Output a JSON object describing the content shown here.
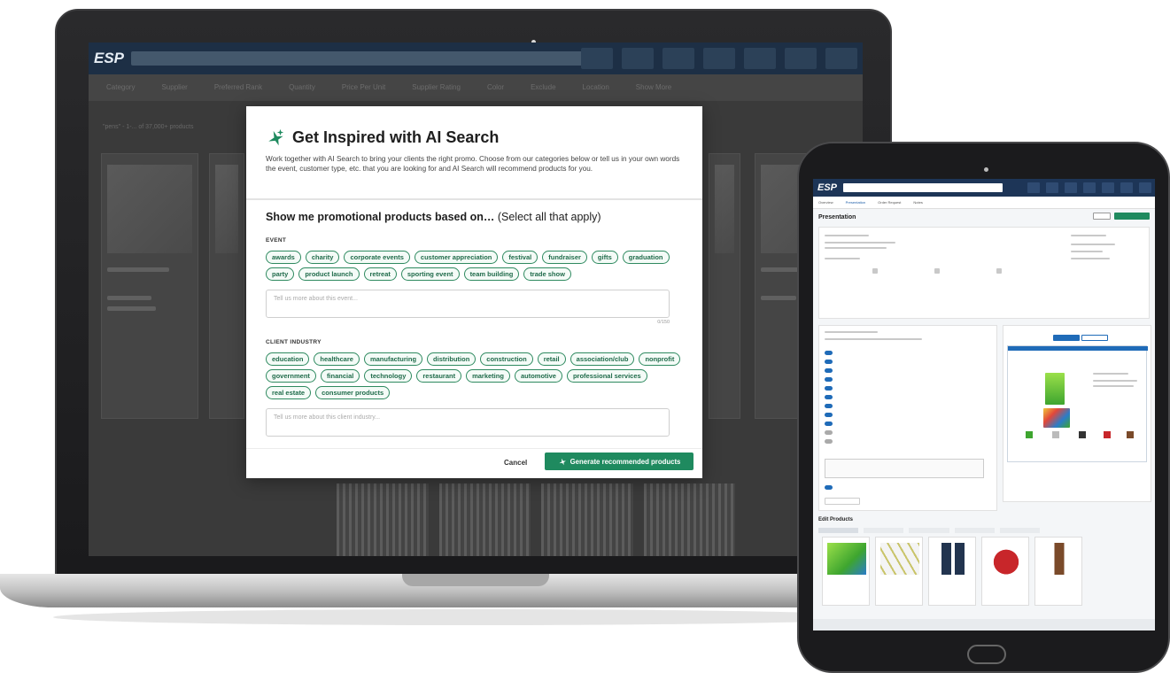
{
  "laptop": {
    "brand": "ESP",
    "filters": [
      "Category",
      "Supplier",
      "Preferred Rank",
      "Quantity",
      "Price Per Unit",
      "Supplier Rating",
      "Color",
      "Exclude",
      "Location",
      "Show More"
    ],
    "results_text": "\"pens\" - 1-... of 37,000+ products",
    "modal": {
      "title": "Get Inspired with AI Search",
      "intro": "Work together with AI Search to bring your clients the right promo. Choose from our categories below or tell us in your own words the event, customer type, etc. that you are looking for and AI Search will recommend products for you.",
      "show_me_bold": "Show me promotional products based on…",
      "show_me_rest": "(Select all that apply)",
      "event_label": "EVENT",
      "event_chips": [
        "awards",
        "charity",
        "corporate events",
        "customer appreciation",
        "festival",
        "fundraiser",
        "gifts",
        "graduation",
        "party",
        "product launch",
        "retreat",
        "sporting event",
        "team building",
        "trade show"
      ],
      "event_placeholder": "Tell us more about this event...",
      "event_counter": "0/150",
      "industry_label": "CLIENT INDUSTRY",
      "industry_chips": [
        "education",
        "healthcare",
        "manufacturing",
        "distribution",
        "construction",
        "retail",
        "association/club",
        "nonprofit",
        "government",
        "financial",
        "technology",
        "restaurant",
        "marketing",
        "automotive",
        "professional services",
        "real estate",
        "consumer products"
      ],
      "industry_placeholder": "Tell us more about this client industry...",
      "cancel_label": "Cancel",
      "generate_label": "Generate recommended products"
    }
  },
  "tablet": {
    "brand": "ESP",
    "tabs": [
      "Overview",
      "Presentation",
      "Order Request",
      "Notes"
    ],
    "page_title": "Presentation",
    "edit_products_title": "Edit Products"
  },
  "colors": {
    "accent_green": "#1f8a5f",
    "chip_green": "#2f8a60",
    "esp_navy": "#1d2f45"
  }
}
